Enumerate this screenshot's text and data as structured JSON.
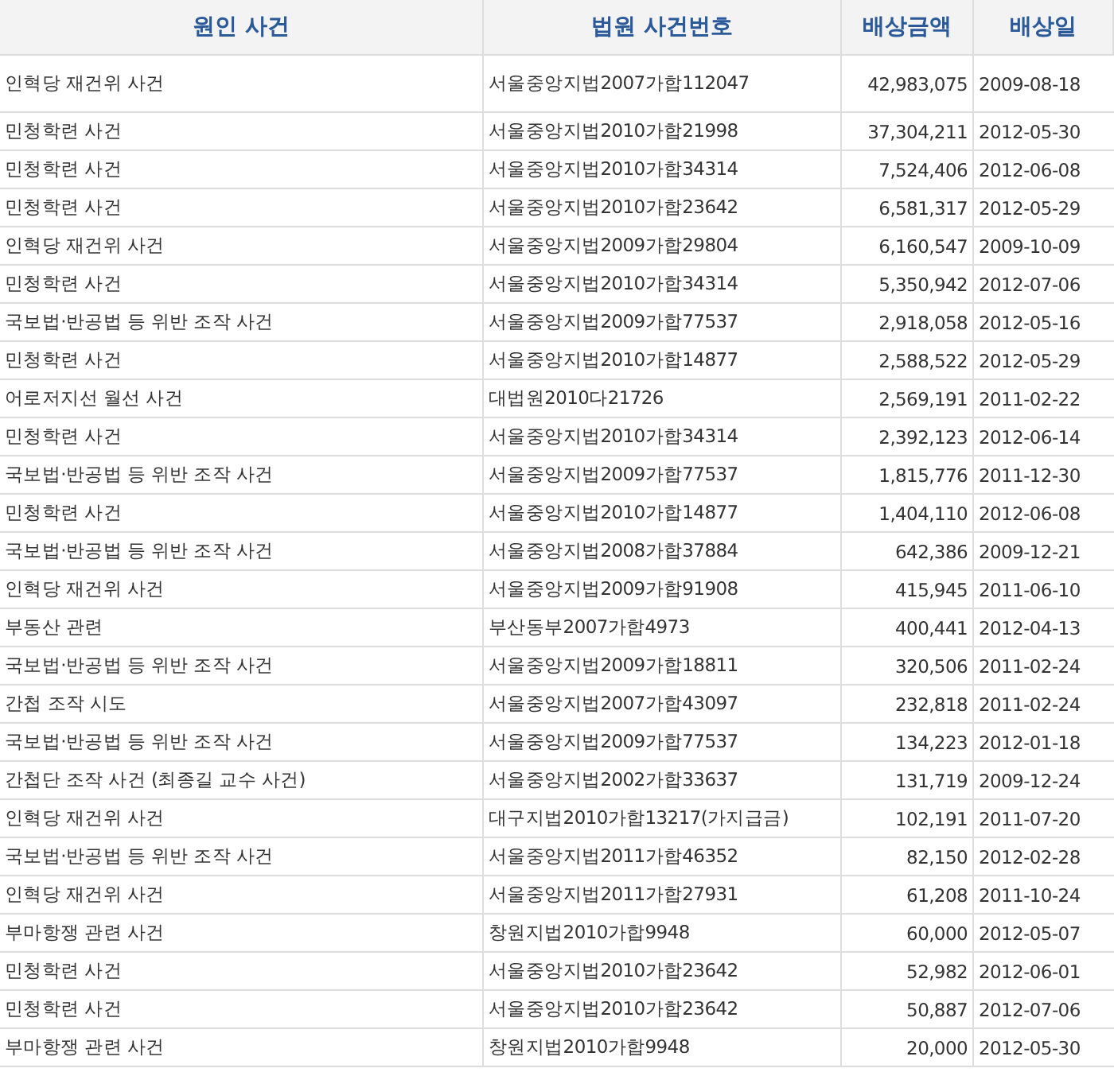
{
  "table": {
    "columns": [
      "원인 사건",
      "법원 사건번호",
      "배상금액",
      "배상일"
    ],
    "rows": [
      [
        "인혁당 재건위 사건",
        "서울중앙지법2007가합112047",
        "42,983,075",
        "2009-08-18"
      ],
      [
        "민청학련 사건",
        "서울중앙지법2010가합21998",
        "37,304,211",
        "2012-05-30"
      ],
      [
        "민청학련 사건",
        "서울중앙지법2010가합34314",
        "7,524,406",
        "2012-06-08"
      ],
      [
        "민청학련 사건",
        "서울중앙지법2010가합23642",
        "6,581,317",
        "2012-05-29"
      ],
      [
        "인혁당 재건위 사건",
        "서울중앙지법2009가합29804",
        "6,160,547",
        "2009-10-09"
      ],
      [
        "민청학련 사건",
        "서울중앙지법2010가합34314",
        "5,350,942",
        "2012-07-06"
      ],
      [
        "국보법·반공법 등 위반 조작 사건",
        "서울중앙지법2009가합77537",
        "2,918,058",
        "2012-05-16"
      ],
      [
        "민청학련 사건",
        "서울중앙지법2010가합14877",
        "2,588,522",
        "2012-05-29"
      ],
      [
        "어로저지선 월선 사건",
        "대법원2010다21726",
        "2,569,191",
        "2011-02-22"
      ],
      [
        "민청학련 사건",
        "서울중앙지법2010가합34314",
        "2,392,123",
        "2012-06-14"
      ],
      [
        "국보법·반공법 등 위반 조작 사건",
        "서울중앙지법2009가합77537",
        "1,815,776",
        "2011-12-30"
      ],
      [
        "민청학련 사건",
        "서울중앙지법2010가합14877",
        "1,404,110",
        "2012-06-08"
      ],
      [
        "국보법·반공법 등 위반 조작 사건",
        "서울중앙지법2008가합37884",
        "642,386",
        "2009-12-21"
      ],
      [
        "인혁당 재건위 사건",
        "서울중앙지법2009가합91908",
        "415,945",
        "2011-06-10"
      ],
      [
        "부동산 관련",
        "부산동부2007가합4973",
        "400,441",
        "2012-04-13"
      ],
      [
        "국보법·반공법 등 위반 조작 사건",
        "서울중앙지법2009가합18811",
        "320,506",
        "2011-02-24"
      ],
      [
        "간첩 조작 시도",
        "서울중앙지법2007가합43097",
        "232,818",
        "2011-02-24"
      ],
      [
        "국보법·반공법 등 위반 조작 사건",
        "서울중앙지법2009가합77537",
        "134,223",
        "2012-01-18"
      ],
      [
        "간첩단 조작 사건 (최종길 교수 사건)",
        "서울중앙지법2002가합33637",
        "131,719",
        "2009-12-24"
      ],
      [
        "인혁당 재건위 사건",
        "대구지법2010가합13217(가지급금)",
        "102,191",
        "2011-07-20"
      ],
      [
        "국보법·반공법 등 위반 조작 사건",
        "서울중앙지법2011가합46352",
        "82,150",
        "2012-02-28"
      ],
      [
        "인혁당 재건위 사건",
        "서울중앙지법2011가합27931",
        "61,208",
        "2011-10-24"
      ],
      [
        "부마항쟁 관련 사건",
        "창원지법2010가합9948",
        "60,000",
        "2012-05-07"
      ],
      [
        "민청학련 사건",
        "서울중앙지법2010가합23642",
        "52,982",
        "2012-06-01"
      ],
      [
        "민청학련 사건",
        "서울중앙지법2010가합23642",
        "50,887",
        "2012-07-06"
      ],
      [
        "부마항쟁 관련 사건",
        "창원지법2010가합9948",
        "20,000",
        "2012-05-30"
      ]
    ]
  }
}
